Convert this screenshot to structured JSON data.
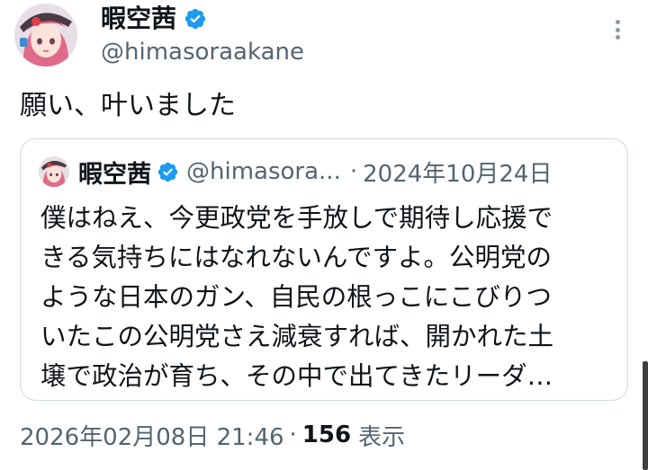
{
  "author": {
    "display_name": "暇空茜",
    "handle": "@himasoraakane",
    "verified": true
  },
  "icons": {
    "verified": "verified-badge-icon",
    "more": "more-options-icon",
    "avatar": "avatar-image"
  },
  "tweet": {
    "text": "願い、叶いました"
  },
  "quote": {
    "display_name": "暇空茜",
    "handle": "@himasora...",
    "separator": "·",
    "date": "2024年10月24日",
    "lines": [
      "僕はねえ、今更政党を手放しで期待し応援で",
      "きる気持ちにはなれないんですよ。公明党の",
      "ような日本のガン、自民の根っこにこびりつ",
      "いたこの公明党さえ減衰すれば、開かれた土",
      "壌で政治が育ち、その中で出てきたリーダ…"
    ]
  },
  "meta": {
    "timestamp": "2026年02月08日 21:46",
    "separator": "·",
    "views_count": "156",
    "views_label": "表示"
  },
  "colors": {
    "text_primary": "#0f1419",
    "text_secondary": "#536471",
    "verified_blue": "#1d9bf0",
    "border": "#cfd9de"
  }
}
